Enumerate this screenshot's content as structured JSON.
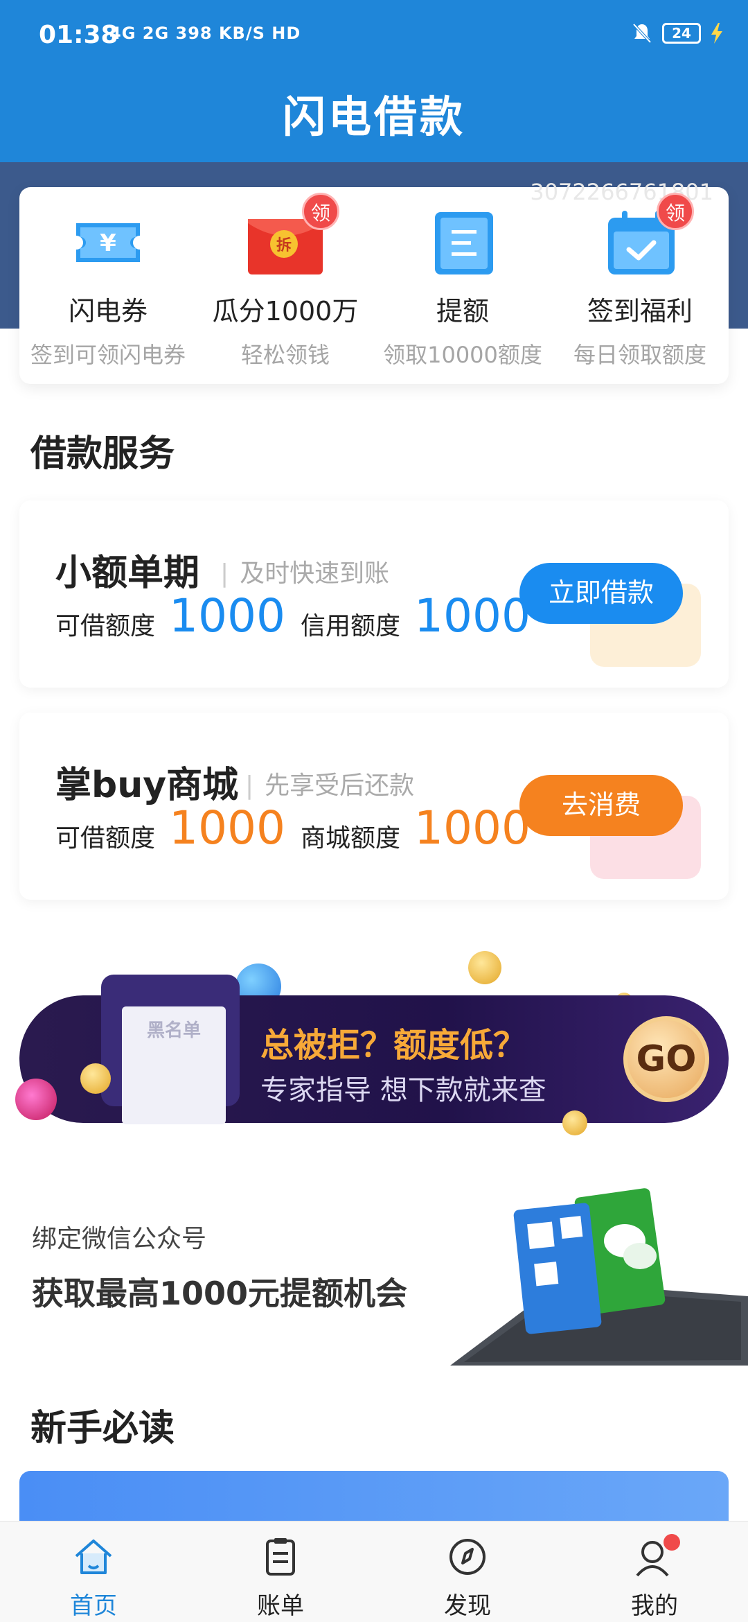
{
  "status": {
    "time": "01:38",
    "network": "4G 2G 398 KB/S HD",
    "battery": "24"
  },
  "app": {
    "title": "闪电借款"
  },
  "watermark": "3072266761801",
  "features": [
    {
      "label": "闪电券",
      "sub": "签到可领闪电券",
      "badge": "",
      "icon": "ticket-icon"
    },
    {
      "label": "瓜分1000万",
      "sub": "轻松领钱",
      "badge": "领",
      "icon": "red-envelope-icon",
      "inner": "拆"
    },
    {
      "label": "提额",
      "sub": "领取10000额度",
      "badge": "",
      "icon": "document-icon"
    },
    {
      "label": "签到福利",
      "sub": "每日领取额度",
      "badge": "领",
      "icon": "calendar-check-icon"
    }
  ],
  "sections": {
    "loan_services": "借款服务",
    "newbie": "新手必读"
  },
  "services": [
    {
      "title": "小额单期",
      "sub": "及时快速到账",
      "label1": "可借额度",
      "amount1": "1000",
      "label2": "信用额度",
      "amount2": "1000",
      "button": "立即借款",
      "accent": "#1a8cf0"
    },
    {
      "title": "掌buy商城",
      "sub": "先享受后还款",
      "label1": "可借额度",
      "amount1": "1000",
      "label2": "商城额度",
      "amount2": "1000",
      "button": "去消费",
      "accent": "#f5821f"
    }
  ],
  "banner": {
    "paper_label": "黑名单",
    "headline": "总被拒？额度低？",
    "subline": "专家指导 想下款就来查",
    "go": "GO"
  },
  "wechat": {
    "small": "绑定微信公众号",
    "big": "获取最高1000元提额机会"
  },
  "tabs": [
    {
      "label": "首页",
      "icon": "home-icon",
      "active": true
    },
    {
      "label": "账单",
      "icon": "bill-icon",
      "active": false
    },
    {
      "label": "发现",
      "icon": "compass-icon",
      "active": false
    },
    {
      "label": "我的",
      "icon": "user-icon",
      "active": false
    }
  ],
  "colors": {
    "primary": "#1f86d9",
    "loan_blue": "#1a8cf0",
    "mall_orange": "#f5821f",
    "badge_red": "#f04a4a"
  }
}
